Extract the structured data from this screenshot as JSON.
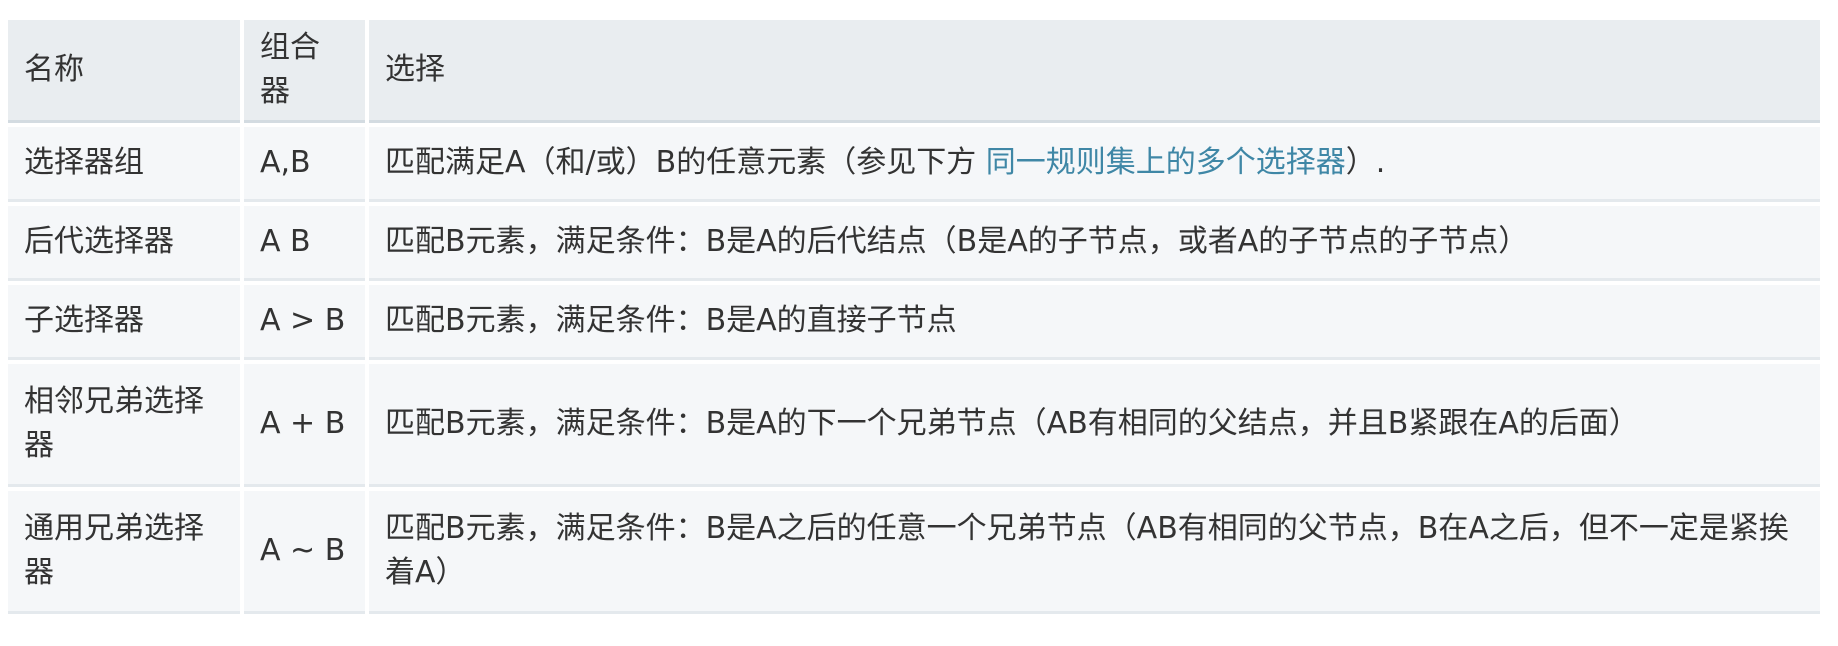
{
  "table": {
    "headers": [
      "名称",
      "组合器",
      "选择"
    ],
    "rows": [
      {
        "name": "选择器组",
        "combinator": "A,B",
        "desc_before": "匹配满足A（和/或）B的任意元素（参见下方 ",
        "desc_link": "同一规则集上的多个选择器",
        "desc_after": "）."
      },
      {
        "name": "后代选择器",
        "combinator": "A B",
        "desc": "匹配B元素，满足条件：B是A的后代结点（B是A的子节点，或者A的子节点的子节点）"
      },
      {
        "name": "子选择器",
        "combinator": "A > B",
        "desc": "匹配B元素，满足条件：B是A的直接子节点"
      },
      {
        "name": "相邻兄弟选择器",
        "combinator": "A + B",
        "desc": "匹配B元素，满足条件：B是A的下一个兄弟节点（AB有相同的父结点，并且B紧跟在A的后面）"
      },
      {
        "name": "通用兄弟选择器",
        "combinator": "A ~ B",
        "desc": "匹配B元素，满足条件：B是A之后的任意一个兄弟节点（AB有相同的父节点，B在A之后，但不一定是紧挨着A）"
      }
    ]
  },
  "colors": {
    "link": "#3f87a6",
    "header_bg": "#e9edf0",
    "cell_bg": "#f5f7f9"
  }
}
